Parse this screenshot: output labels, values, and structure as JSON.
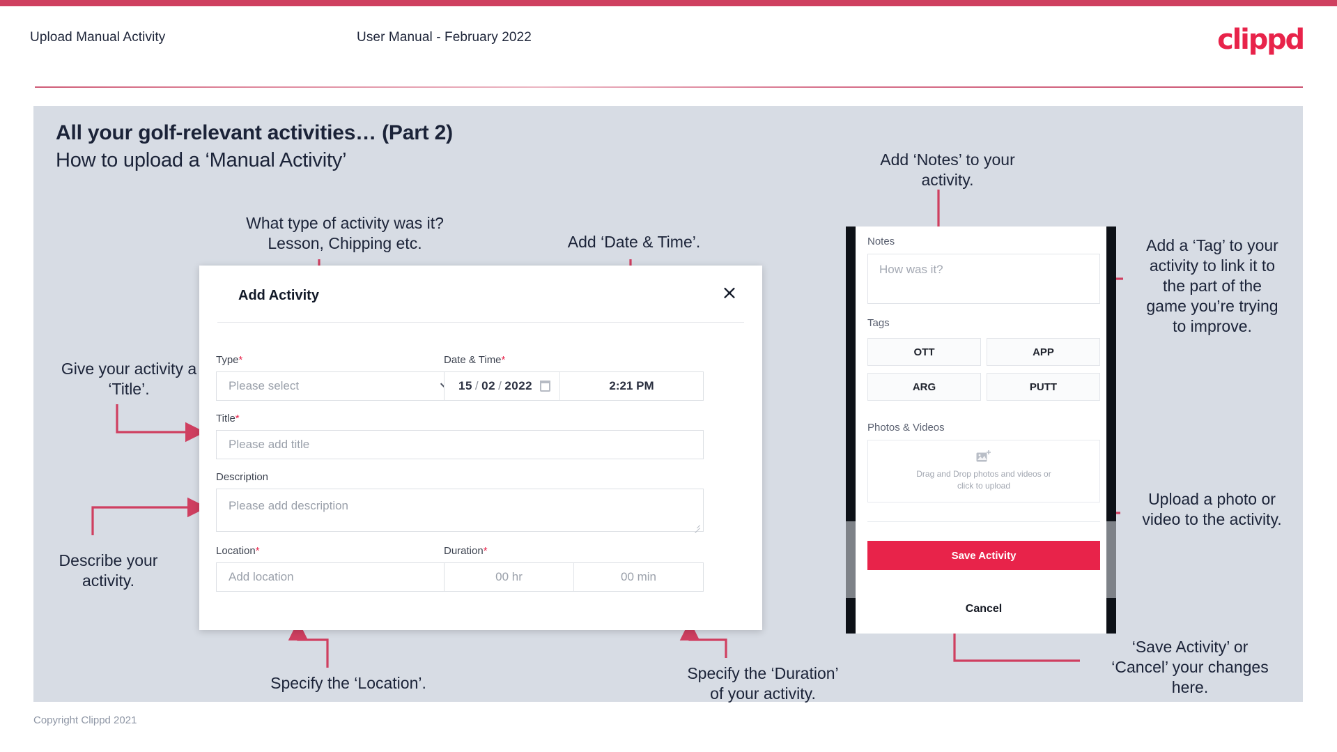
{
  "header": {
    "left_title": "Upload Manual Activity",
    "center_title": "User Manual - February 2022",
    "logo": "clippd"
  },
  "slide": {
    "title": "All your golf-relevant activities… (Part 2)",
    "subtitle": "How to upload a ‘Manual Activity’",
    "copyright": "Copyright Clippd 2021"
  },
  "annotations": {
    "type": "What type of activity was it?\nLesson, Chipping etc.",
    "datetime": "Add ‘Date & Time’.",
    "title": "Give your activity a\n‘Title’.",
    "description": "Describe your\nactivity.",
    "location": "Specify the ‘Location’.",
    "duration": "Specify the ‘Duration’\nof your activity.",
    "notes": "Add ‘Notes’ to your\nactivity.",
    "tags": "Add a ‘Tag’ to your\nactivity to link it to\nthe part of the\ngame you’re trying\nto improve.",
    "upload": "Upload a photo or\nvideo to the activity.",
    "save_cancel": "‘Save Activity’ or\n‘Cancel’ your changes\nhere."
  },
  "dialog": {
    "title": "Add Activity",
    "close_icon": "×",
    "fields": {
      "type": {
        "label": "Type",
        "required": "*",
        "placeholder": "Please select"
      },
      "datetime": {
        "label": "Date & Time",
        "required": "*",
        "day": "15",
        "month": "02",
        "year": "2022",
        "slash": "/",
        "time": "2:21 PM"
      },
      "title": {
        "label": "Title",
        "required": "*",
        "placeholder": "Please add title"
      },
      "description": {
        "label": "Description",
        "required": "",
        "placeholder": "Please add description"
      },
      "location": {
        "label": "Location",
        "required": "*",
        "placeholder": "Add location"
      },
      "duration": {
        "label": "Duration",
        "required": "*",
        "hours_placeholder": "00 hr",
        "minutes_placeholder": "00 min"
      }
    }
  },
  "mobile": {
    "notes_label": "Notes",
    "notes_placeholder": "How was it?",
    "tags_label": "Tags",
    "tags": [
      "OTT",
      "APP",
      "ARG",
      "PUTT"
    ],
    "photos_label": "Photos & Videos",
    "upload_line1": "Drag and Drop photos and videos or",
    "upload_line2": "click to upload",
    "save_label": "Save Activity",
    "cancel_label": "Cancel"
  },
  "colors": {
    "brand": "#e8234a",
    "top_bar": "#cf4060",
    "slide_bg": "#d7dce4",
    "text_dark": "#1b2338",
    "arrow": "#cf3f60"
  }
}
